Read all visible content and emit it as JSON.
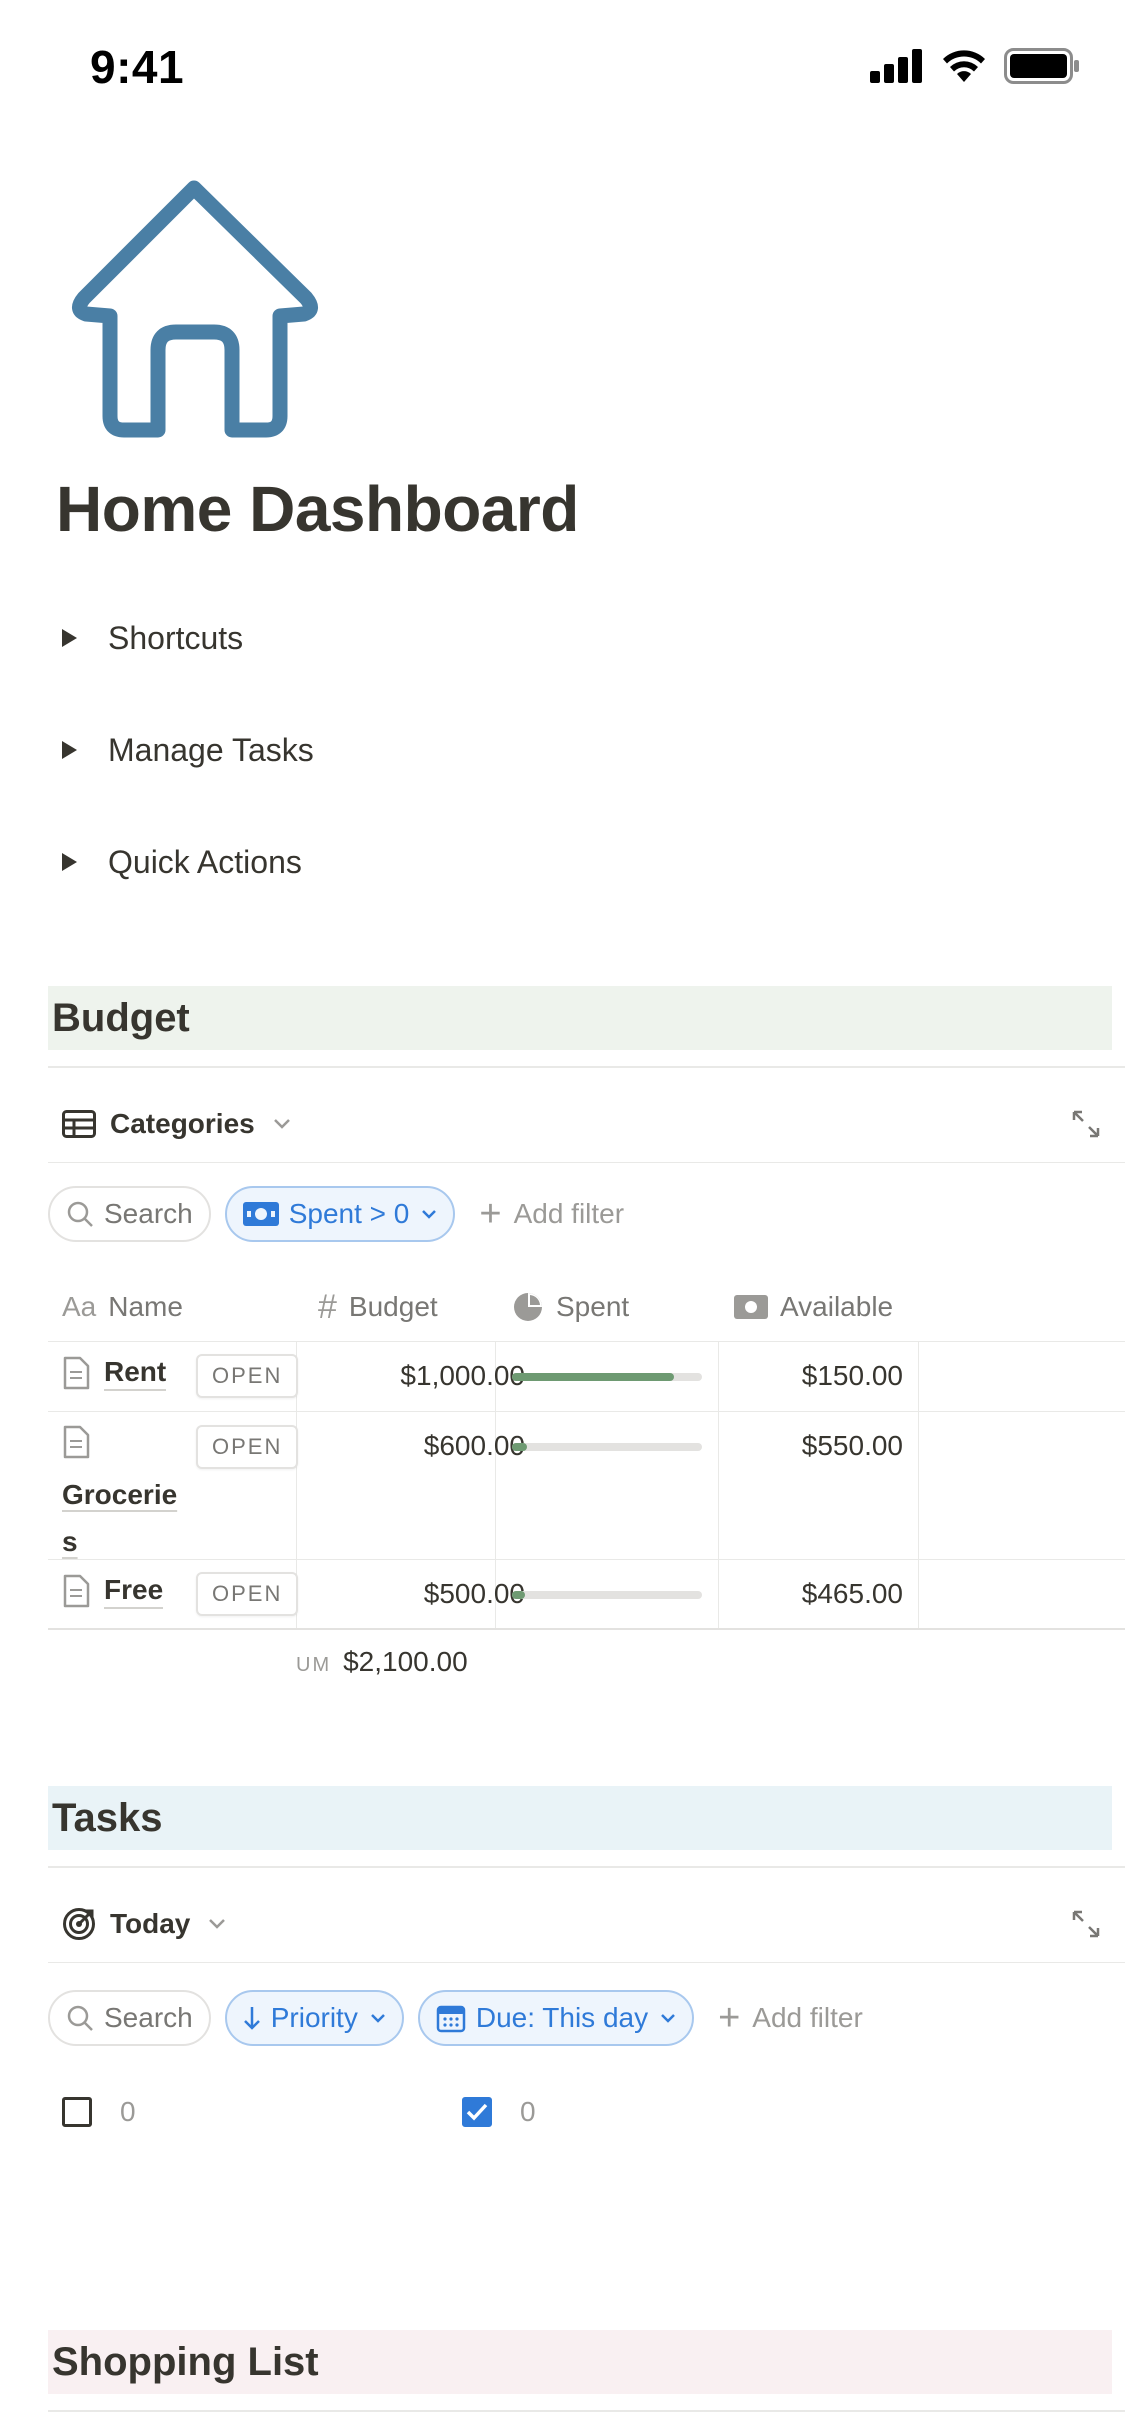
{
  "status_bar": {
    "time": "9:41"
  },
  "page": {
    "title": "Home Dashboard",
    "icon": "house-icon"
  },
  "toggles": [
    {
      "label": "Shortcuts"
    },
    {
      "label": "Manage Tasks"
    },
    {
      "label": "Quick Actions"
    }
  ],
  "budget": {
    "heading": "Budget",
    "view_name": "Categories",
    "search_label": "Search",
    "filter_label": "Spent > 0",
    "add_filter_label": "Add filter",
    "columns": {
      "name": "Name",
      "budget": "Budget",
      "spent": "Spent",
      "available": "Available"
    },
    "open_label": "OPEN",
    "rows": [
      {
        "name": "Rent",
        "budget": "$1,000.00",
        "spent_fraction": 0.85,
        "available": "$150.00"
      },
      {
        "name": "Groceries",
        "budget": "$600.00",
        "spent_fraction": 0.08,
        "available": "$550.00"
      },
      {
        "name": "Free",
        "budget": "$500.00",
        "spent_fraction": 0.07,
        "available": "$465.00"
      }
    ],
    "sum_label": "UM",
    "sum_value": "$2,100.00",
    "accent": "#6e9a72"
  },
  "tasks": {
    "heading": "Tasks",
    "view_name": "Today",
    "search_label": "Search",
    "sort_label": "Priority",
    "due_filter_label": "Due: This day",
    "add_filter_label": "Add filter",
    "unchecked_count": "0",
    "checked_count": "0"
  },
  "shopping": {
    "heading": "Shopping List"
  },
  "colors": {
    "text": "#37352f",
    "muted": "#787774",
    "blue": "#2f7ad8",
    "house_icon": "#4a7fa5"
  }
}
